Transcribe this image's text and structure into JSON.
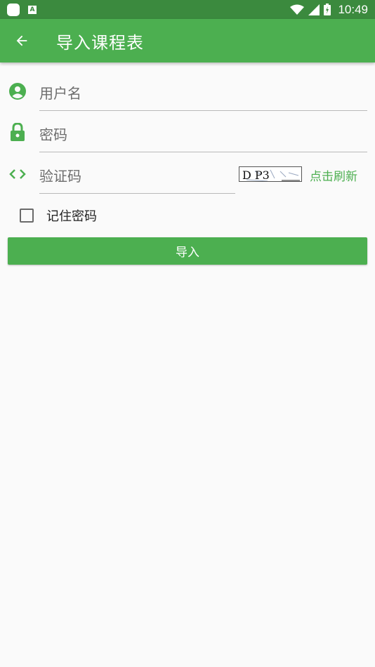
{
  "status_bar": {
    "time": "10:49",
    "icons": [
      "notification-icon",
      "a-icon",
      "wifi-icon",
      "signal-icon",
      "battery-icon"
    ]
  },
  "app_bar": {
    "title": "导入课程表",
    "back_icon": "arrow-left-icon"
  },
  "form": {
    "username": {
      "placeholder": "用户名",
      "icon": "account-circle-icon"
    },
    "password": {
      "placeholder": "密码",
      "icon": "lock-icon"
    },
    "captcha": {
      "placeholder": "验证码",
      "icon": "code-brackets-icon",
      "image_text": "D P3",
      "refresh_label": "点击刷新"
    },
    "remember": {
      "label": "记住密码",
      "checked": false
    },
    "submit_label": "导入"
  },
  "colors": {
    "primary": "#4caf50",
    "primary_dark": "#3b8a3e",
    "background": "#fafafa",
    "divider": "#b9b9b9"
  }
}
